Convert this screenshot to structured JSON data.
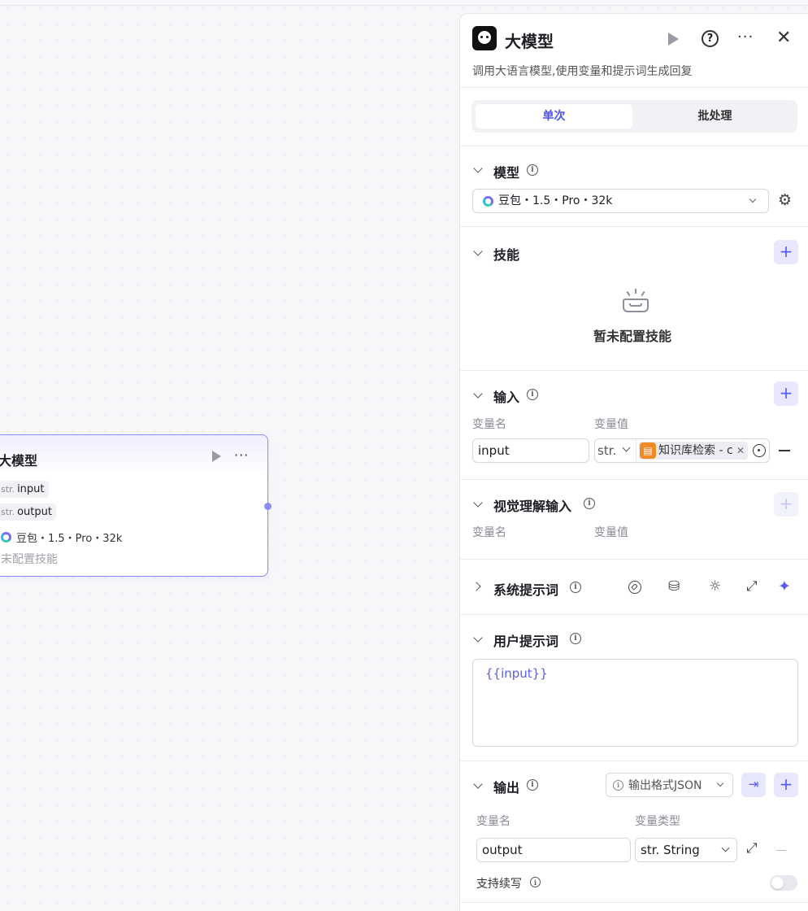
{
  "node": {
    "title": "大模型",
    "vars": [
      {
        "type": "str.",
        "name": "input"
      },
      {
        "type": "str.",
        "name": "output"
      }
    ],
    "model": "豆包・1.5・Pro・32k",
    "skills_empty": "未配置技能"
  },
  "panel": {
    "title": "大模型",
    "description": "调用大语言模型,使用变量和提示词生成回复",
    "tabs": [
      {
        "label": "单次",
        "active": true
      },
      {
        "label": "批处理",
        "active": false
      }
    ],
    "model_section": {
      "title": "模型",
      "selected": "豆包・1.5・Pro・32k"
    },
    "skills_section": {
      "title": "技能",
      "empty_text": "暂未配置技能"
    },
    "input_section": {
      "title": "输入",
      "col_name": "变量名",
      "col_value": "变量值",
      "rows": [
        {
          "name": "input",
          "type": "str.",
          "ref": "知识库检索 - c"
        }
      ]
    },
    "vision_section": {
      "title": "视觉理解输入",
      "col_name": "变量名",
      "col_value": "变量值"
    },
    "system_prompt": {
      "title": "系统提示词"
    },
    "user_prompt": {
      "title": "用户提示词",
      "value": "{{input}}"
    },
    "output_section": {
      "title": "输出",
      "format_label": "输出格式JSON",
      "col_name": "变量名",
      "col_type": "变量类型",
      "rows": [
        {
          "name": "output",
          "type": "str. String"
        }
      ],
      "stream_label": "支持续写",
      "stream_enabled": false
    }
  },
  "colors": {
    "accent": "#5a5cf0",
    "node_border": "#8b8cf2",
    "ref_tag": "#f08a24"
  }
}
